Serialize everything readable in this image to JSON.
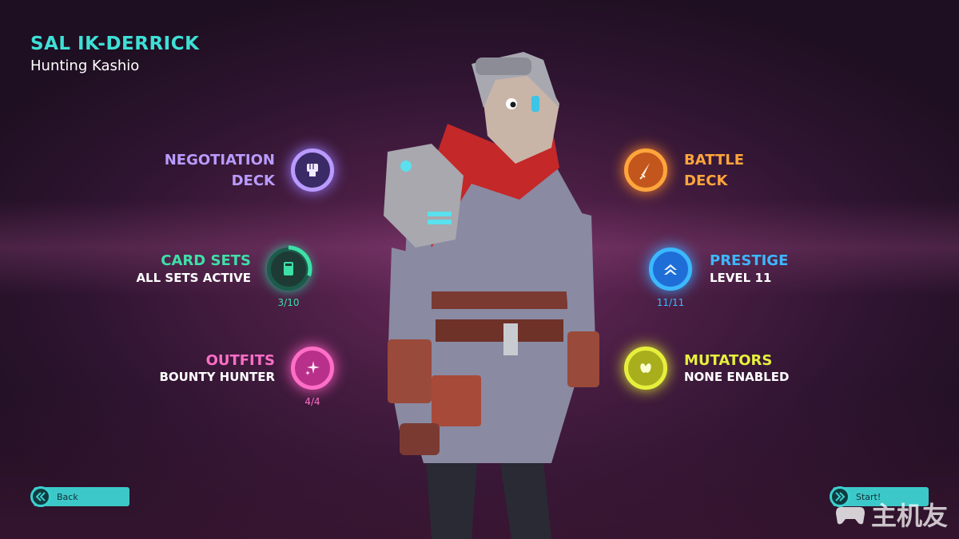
{
  "header": {
    "name": "SAL IK-DERRICK",
    "subtitle": "Hunting Kashio"
  },
  "options": {
    "negotiation": {
      "label_line1": "NEGOTIATION",
      "label_line2": "DECK",
      "color": "#b99bff",
      "icon": "fist-icon"
    },
    "battle": {
      "label_line1": "BATTLE",
      "label_line2": "DECK",
      "color": "#ffa53c",
      "icon": "dagger-icon"
    },
    "card_sets": {
      "label": "CARD SETS",
      "value": "ALL SETS ACTIVE",
      "count": "3/10",
      "progress": 0.3,
      "color": "#3ee0a8",
      "icon": "card-icon"
    },
    "prestige": {
      "label": "PRESTIGE",
      "value": "LEVEL 11",
      "count": "11/11",
      "progress": 1.0,
      "color": "#3cb8ff",
      "icon": "chevron-up-icon"
    },
    "outfits": {
      "label": "OUTFITS",
      "value": "BOUNTY HUNTER",
      "count": "4/4",
      "progress": 1.0,
      "color": "#ff6ec7",
      "icon": "sparkle-icon"
    },
    "mutators": {
      "label": "MUTATORS",
      "value": "NONE ENABLED",
      "color": "#e6f03c",
      "icon": "beans-icon"
    }
  },
  "buttons": {
    "back": "Back",
    "start": "Start!"
  },
  "watermark": "主机友"
}
